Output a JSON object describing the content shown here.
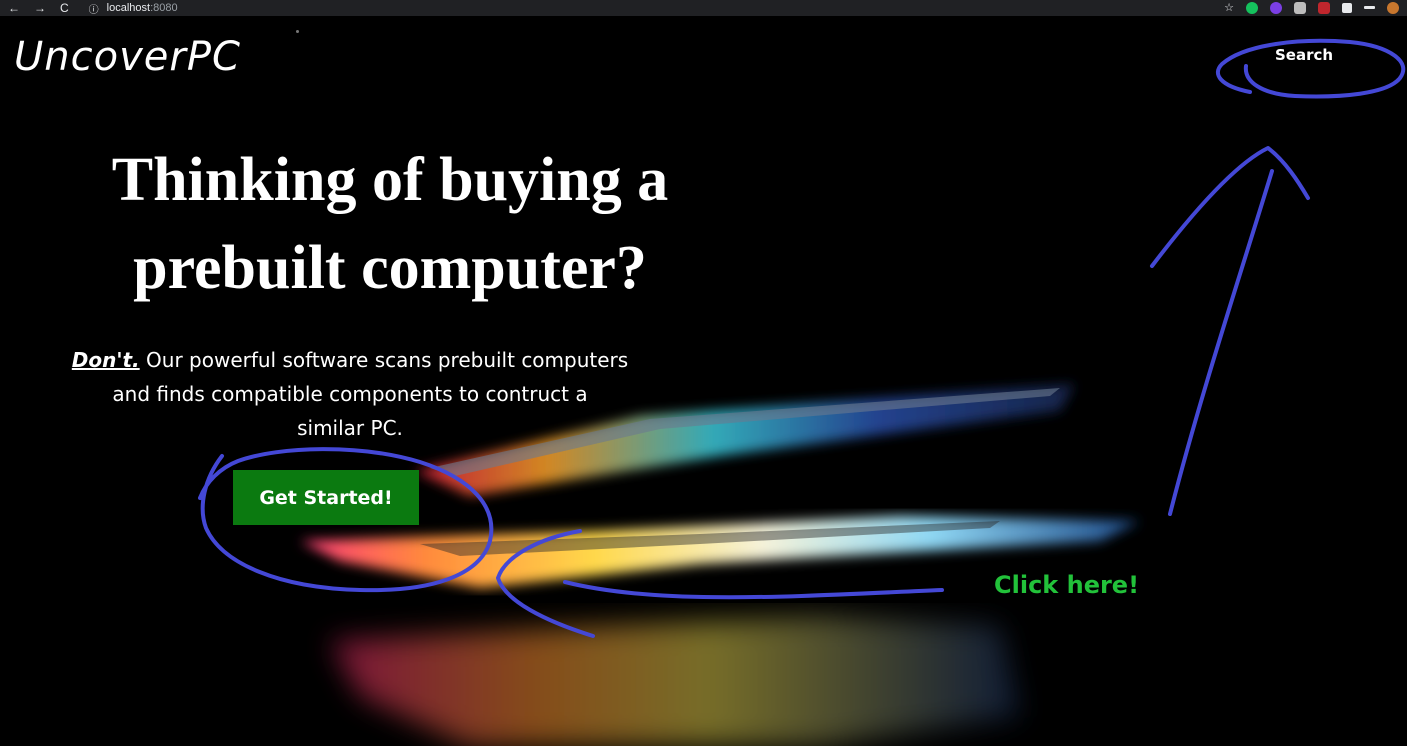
{
  "browser": {
    "back_icon": "←",
    "forward_icon": "→",
    "reload_icon": "C",
    "info_icon": "ⓘ",
    "host": "localhost",
    "port": ":8080",
    "star_icon": "☆"
  },
  "header": {
    "logo": "UncoverPC",
    "search_label": "Search"
  },
  "hero": {
    "headline_line1": "Thinking of buying a",
    "headline_line2": "prebuilt computer?",
    "dont": "Don't.",
    "description_line1": " Our powerful software scans prebuilt computers",
    "description_line2": "and finds compatible components to contruct a",
    "description_line3": "similar PC.",
    "cta_label": "Get Started!"
  },
  "annotations": {
    "click_here": "Click here!",
    "ink_color": "#4448d6",
    "text_color": "#22c23a"
  }
}
